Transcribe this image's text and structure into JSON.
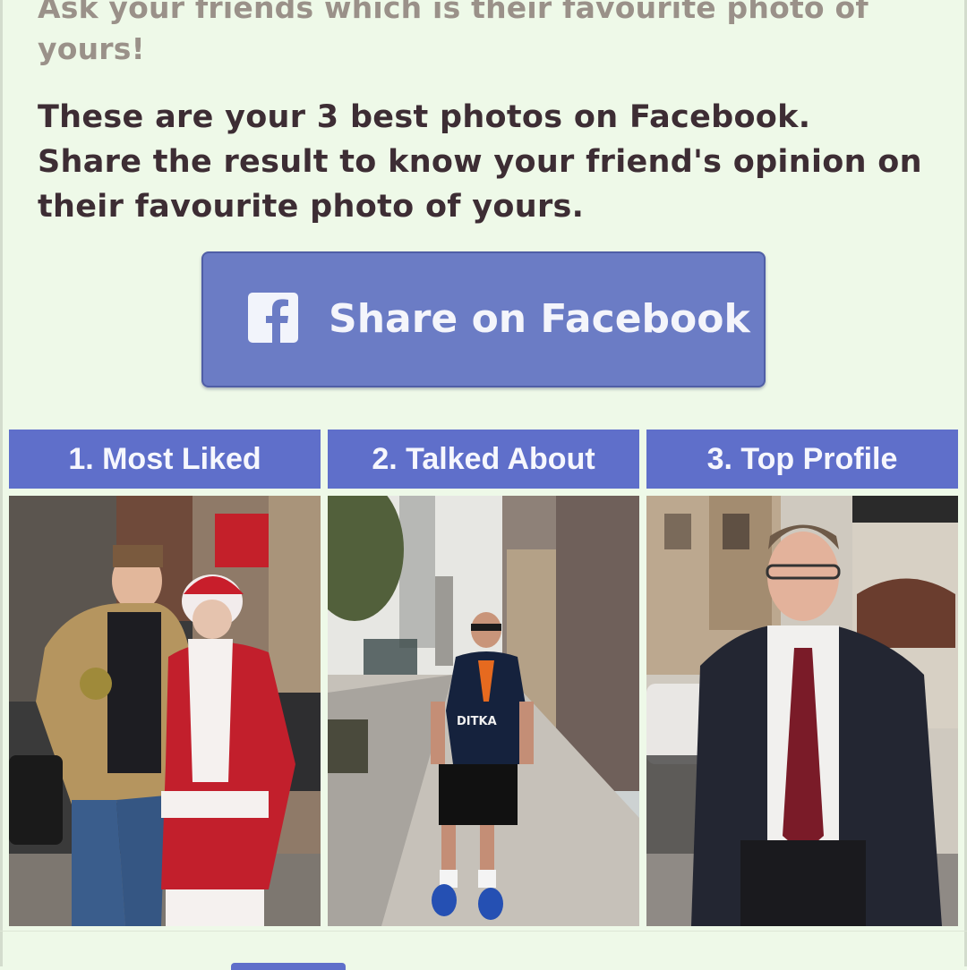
{
  "quiz": {
    "subtitle": "Ask your friends which is their favourite photo of yours!",
    "headline": "These are your 3 best photos on Facebook. Share the result to know your friend's opinion on their favourite photo of yours."
  },
  "share_button": {
    "label": "Share on Facebook",
    "icon": "facebook-icon",
    "color": "#6b7cc5"
  },
  "photos": [
    {
      "label": "1. Most Liked"
    },
    {
      "label": "2. Talked About"
    },
    {
      "label": "3. Top Profile"
    }
  ],
  "colors": {
    "background": "#eef9e8",
    "header_bar": "#5f6fca",
    "headline_text": "#3d2d34",
    "subtitle_text": "#9a9189"
  }
}
